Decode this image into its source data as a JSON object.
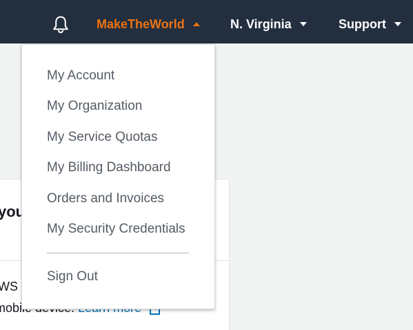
{
  "header": {
    "notifications_icon": "bell-icon",
    "account_label": "MakeTheWorld",
    "region_label": "N. Virginia",
    "support_label": "Support",
    "colors": {
      "bar": "#232f3e",
      "accent": "#ec7211",
      "text": "#ffffff"
    }
  },
  "account_menu": {
    "items": [
      {
        "label": "My Account"
      },
      {
        "label": "My Organization"
      },
      {
        "label": "My Service Quotas"
      },
      {
        "label": "My Billing Dashboard"
      },
      {
        "label": "Orders and Invoices"
      },
      {
        "label": "My Security Credentials"
      }
    ],
    "sign_out_label": "Sign Out"
  },
  "background": {
    "heading_fragment": "you",
    "line1_fragment": "WS",
    "line2_fragment": "mobile device.",
    "link_label": "Learn more",
    "link_icon": "external-link-icon"
  }
}
